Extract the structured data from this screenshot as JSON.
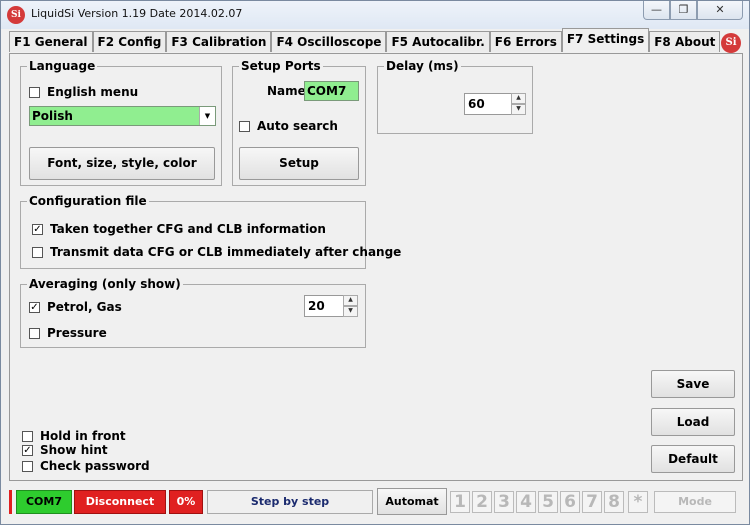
{
  "window": {
    "logo": "Si",
    "title": "LiquidSi  Version 1.19  Date 2014.02.07",
    "minimize_icon": "—",
    "restore_icon": "❐",
    "close_icon": "✕"
  },
  "tabs": [
    {
      "label": "F1 General"
    },
    {
      "label": "F2 Config"
    },
    {
      "label": "F3 Calibration"
    },
    {
      "label": "F4 Oscilloscope"
    },
    {
      "label": "F5 Autocalibr."
    },
    {
      "label": "F6 Errors"
    },
    {
      "label": "F7 Settings",
      "active": true
    },
    {
      "label": "F8 About"
    }
  ],
  "language": {
    "legend": "Language",
    "english_menu_label": "English menu",
    "english_menu_checked": false,
    "selected": "Polish",
    "font_button": "Font, size, style, color"
  },
  "setup_ports": {
    "legend": "Setup Ports",
    "name_label": "Name",
    "name_value": "COM7",
    "auto_search_label": "Auto search",
    "auto_search_checked": false,
    "setup_button": "Setup"
  },
  "delay": {
    "legend": "Delay (ms)",
    "value": "60"
  },
  "config_file": {
    "legend": "Configuration file",
    "opt1_label": "Taken together CFG and CLB information",
    "opt1_checked": true,
    "opt2_label": "Transmit data CFG or CLB immediately after change",
    "opt2_checked": false
  },
  "averaging": {
    "legend": "Averaging (only show)",
    "petrol_label": "Petrol, Gas",
    "petrol_checked": true,
    "petrol_value": "20",
    "pressure_label": "Pressure",
    "pressure_checked": false
  },
  "side_buttons": {
    "save": "Save",
    "load": "Load",
    "default": "Default"
  },
  "bottom_checks": {
    "hold_label": "Hold in front",
    "hold_checked": false,
    "hint_label": "Show hint",
    "hint_checked": true,
    "password_label": "Check password",
    "password_checked": false
  },
  "status_bar": {
    "port": "COM7",
    "disconnect": "Disconnect",
    "percent": "0%",
    "step": "Step by step",
    "automat": "Automat",
    "numbers": [
      "1",
      "2",
      "3",
      "4",
      "5",
      "6",
      "7",
      "8",
      "*"
    ],
    "mode": "Mode"
  },
  "colors": {
    "green": "#2ecc2e",
    "red": "#e02020",
    "field_green": "#90ee90"
  }
}
